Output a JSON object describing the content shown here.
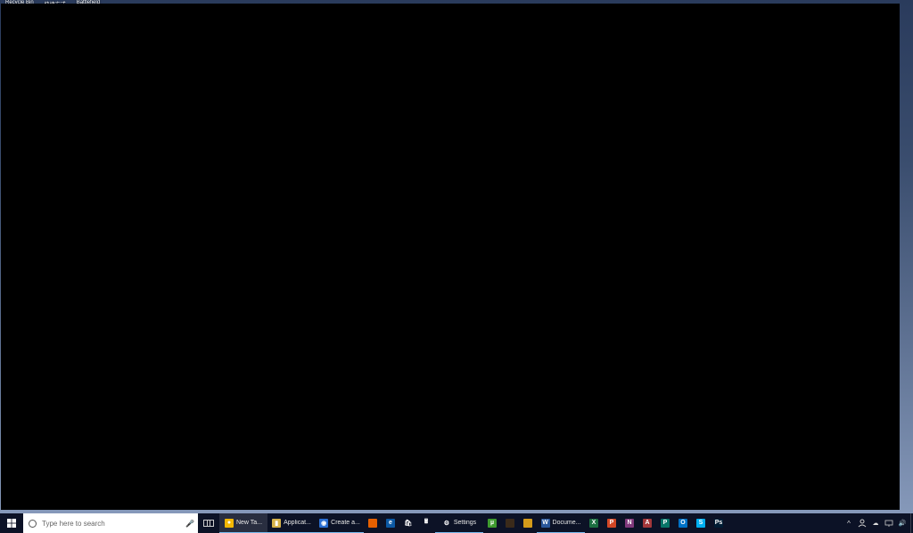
{
  "desktop": {
    "labels": [
      "Recycle Bin",
      "快捷方式",
      "Battlefield"
    ]
  },
  "search": {
    "placeholder": "Type here to search"
  },
  "taskbar": {
    "items": [
      {
        "name": "new-tab-chrome",
        "label": "New Ta...",
        "bg": "#f2b705",
        "glyph": "●",
        "running": true,
        "active": true
      },
      {
        "name": "application",
        "label": "Applicat...",
        "bg": "#d6b24a",
        "glyph": "▮",
        "running": true,
        "active": false
      },
      {
        "name": "create-a",
        "label": "Create a...",
        "bg": "#2a6ed1",
        "glyph": "◉",
        "running": true,
        "active": false
      }
    ],
    "pinned_icons": [
      {
        "name": "firefox",
        "bg": "#e66000",
        "glyph": ""
      },
      {
        "name": "edge",
        "bg": "#0c59a4",
        "glyph": "e"
      },
      {
        "name": "store",
        "bg": "#0c1226",
        "glyph": "🛍"
      },
      {
        "name": "calculator",
        "bg": "#0c1226",
        "glyph": "🖩"
      }
    ],
    "settings_item": {
      "name": "settings",
      "label": "Settings",
      "glyph": "⚙",
      "running": true
    },
    "extra_icons": [
      {
        "name": "utorrent",
        "bg": "#3f9b2f",
        "glyph": "µ"
      },
      {
        "name": "app-a",
        "bg": "#3a2a1a",
        "glyph": ""
      },
      {
        "name": "app-b",
        "bg": "#d49b1a",
        "glyph": ""
      }
    ],
    "word_item": {
      "name": "word",
      "label": "Docume...",
      "bg": "#2a579a",
      "glyph": "W",
      "running": true
    },
    "office_icons": [
      {
        "name": "excel",
        "bg": "#1d6f42",
        "glyph": "X"
      },
      {
        "name": "powerpoint",
        "bg": "#d24726",
        "glyph": "P"
      },
      {
        "name": "onenote",
        "bg": "#80397b",
        "glyph": "N"
      },
      {
        "name": "access",
        "bg": "#a4373a",
        "glyph": "A"
      },
      {
        "name": "publisher",
        "bg": "#077568",
        "glyph": "P"
      },
      {
        "name": "outlook",
        "bg": "#0072c6",
        "glyph": "O"
      },
      {
        "name": "skype",
        "bg": "#00aff0",
        "glyph": "S"
      },
      {
        "name": "photoshop",
        "bg": "#001d34",
        "glyph": "Ps"
      }
    ]
  },
  "tray": {
    "icons": [
      "people-icon",
      "cloud-icon",
      "network-icon",
      "volume-icon"
    ]
  }
}
